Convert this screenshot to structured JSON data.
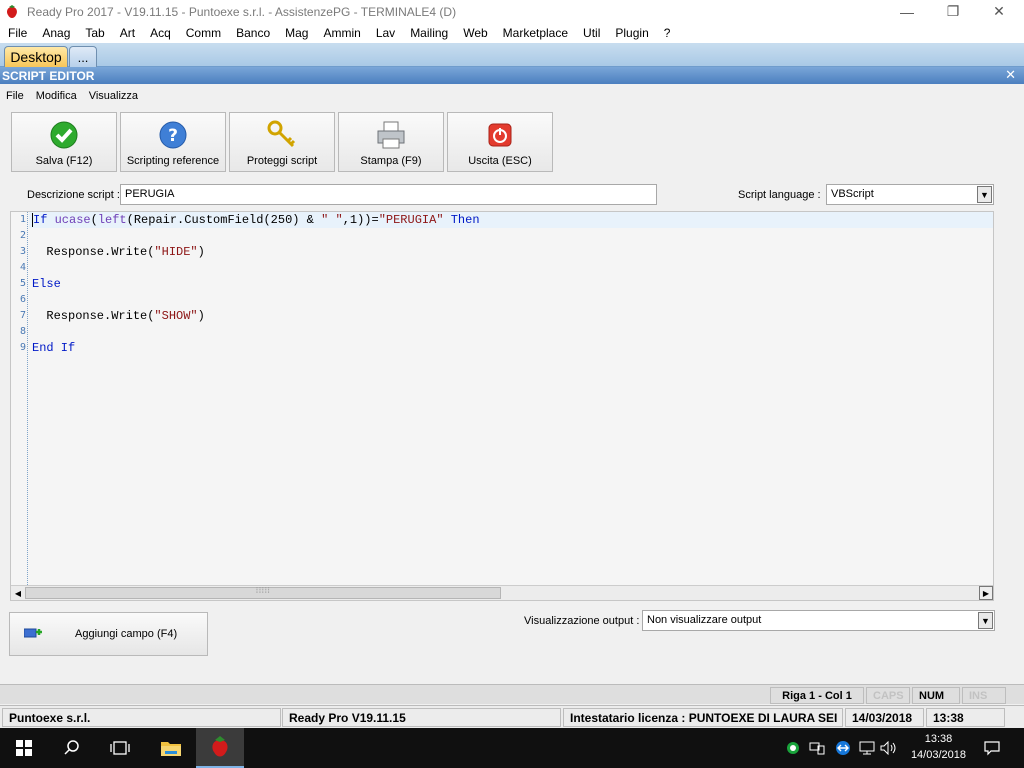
{
  "window": {
    "title": "Ready Pro 2017 - V19.11.15 - Puntoexe s.r.l. - AssistenzePG - TERMINALE4 (D)",
    "controls": [
      "—",
      "❐",
      "✕"
    ]
  },
  "menubar": [
    "File",
    "Anag",
    "Tab",
    "Art",
    "Acq",
    "Comm",
    "Banco",
    "Mag",
    "Ammin",
    "Lav",
    "Mailing",
    "Web",
    "Marketplace",
    "Util",
    "Plugin",
    "?"
  ],
  "tabs": {
    "active": "Desktop",
    "more": "..."
  },
  "editor_panel": {
    "title": "SCRIPT EDITOR",
    "close": "✕",
    "submenu": [
      "File",
      "Modifica",
      "Visualizza"
    ],
    "toolbar": [
      {
        "label": "Salva (F12)",
        "icon": "check-icon"
      },
      {
        "label": "Scripting reference",
        "icon": "help-icon"
      },
      {
        "label": "Proteggi script",
        "icon": "key-icon"
      },
      {
        "label": "Stampa (F9)",
        "icon": "printer-icon"
      },
      {
        "label": "Uscita (ESC)",
        "icon": "power-icon"
      }
    ],
    "description_label": "Descrizione script :",
    "description_value": "PERUGIA",
    "language_label": "Script language :",
    "language_value": "VBScript",
    "line_numbers": [
      "1",
      "2",
      "3",
      "4",
      "5",
      "6",
      "7",
      "8",
      "9"
    ],
    "output_label": "Visualizzazione output :",
    "output_value": "Non visualizzare output",
    "add_field_label": "Aggiungi campo (F4)"
  },
  "status": {
    "position": "Riga 1 - Col 1",
    "caps": "CAPS",
    "num": "NUM",
    "ins": "INS",
    "company": "Puntoexe s.r.l.",
    "version": "Ready Pro V19.11.15",
    "license": "Intestatario licenza : PUNTOEXE DI LAURA SEI",
    "date": "14/03/2018",
    "time": "13:38"
  },
  "taskbar": {
    "time": "13:38",
    "date": "14/03/2018"
  },
  "colors": {
    "keyword": "#0019c7",
    "string": "#8d1515",
    "function": "#6f3fb7",
    "header": "#4b7fbf"
  }
}
